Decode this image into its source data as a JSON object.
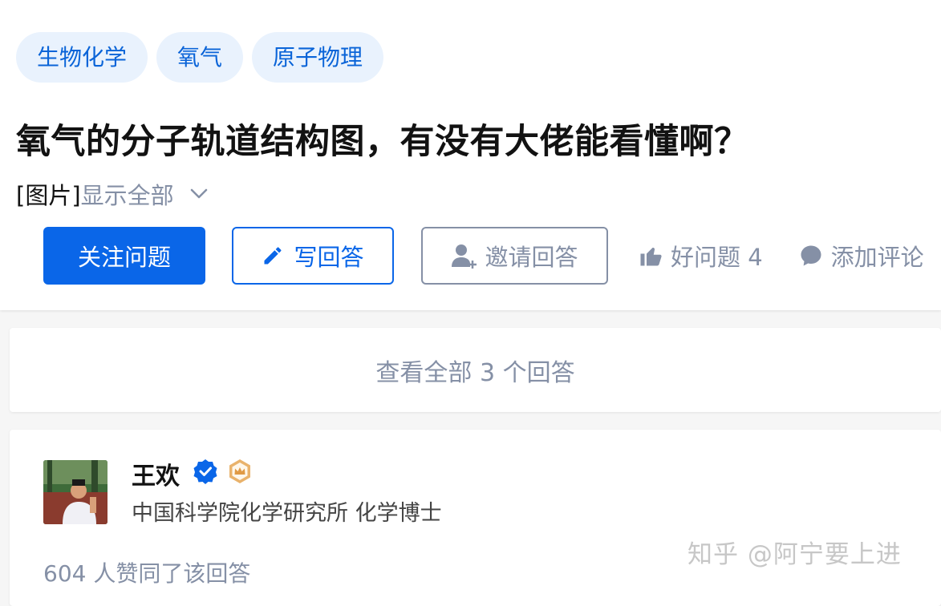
{
  "topics": [
    "生物化学",
    "氧气",
    "原子物理"
  ],
  "question": {
    "title": "氧气的分子轨道结构图，有没有大佬能看懂啊？",
    "detail_prefix": "[图片]",
    "show_all": "显示全部"
  },
  "actions": {
    "follow": "关注问题",
    "write": "写回答",
    "invite": "邀请回答",
    "good_question": "好问题 4",
    "comment": "添加评论"
  },
  "view_all": "查看全部 3 个回答",
  "answer": {
    "author_name": "王欢",
    "author_bio": "中国科学院化学研究所 化学博士",
    "votes": "604 人赞同了该回答"
  },
  "watermark": "知乎 @阿宁要上进",
  "colors": {
    "brand": "#0a66e8",
    "tag_bg": "#e9f2fd",
    "muted": "#8590a6"
  },
  "icons": {
    "show_all": "chevron-down-icon",
    "write": "pencil-icon",
    "invite": "add-user-icon",
    "good_question": "thumbs-up-icon",
    "comment": "comment-bubble-icon",
    "verified": "verified-badge-icon",
    "crown": "crown-badge-icon"
  }
}
